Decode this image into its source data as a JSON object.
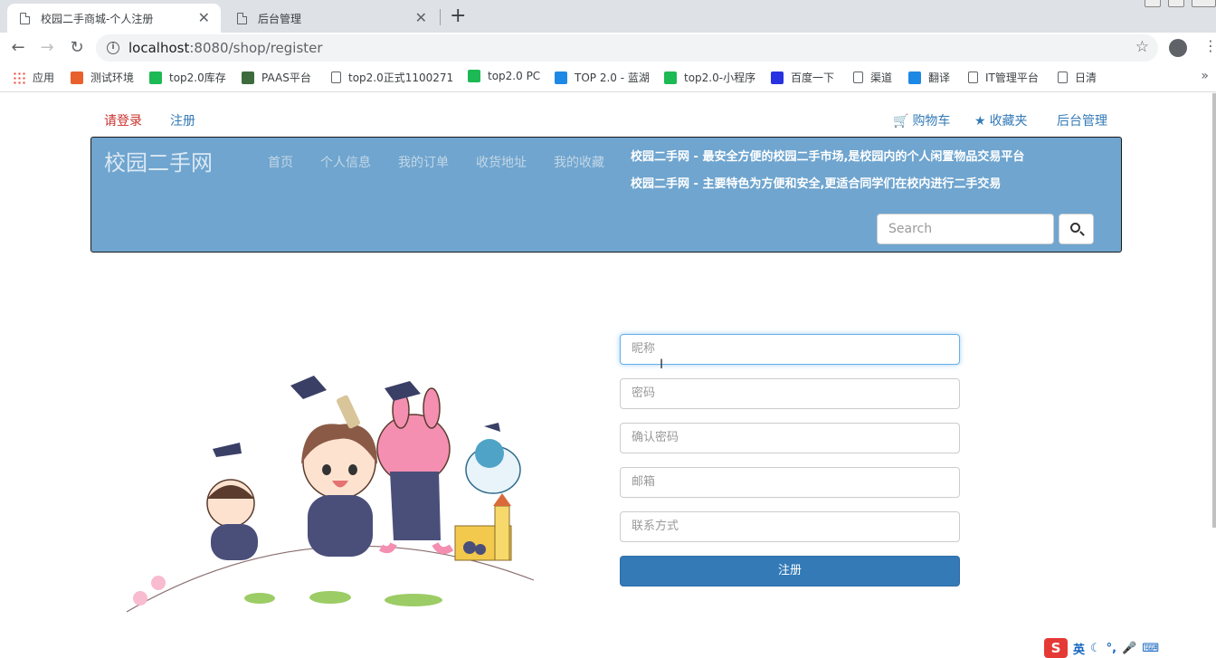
{
  "browser": {
    "tabs": [
      {
        "title": "校园二手商城-个人注册",
        "active": true
      },
      {
        "title": "后台管理",
        "active": false
      }
    ],
    "new_tab": "+",
    "url_host": "localhost",
    "url_rest": ":8080/shop/register",
    "bookmarks": [
      {
        "label": "应用",
        "icon": "apps-icon"
      },
      {
        "label": "测试环境",
        "icon": "u-icon",
        "color": "#e8602c"
      },
      {
        "label": "top2.0库存",
        "icon": "play-icon",
        "color": "#1db954"
      },
      {
        "label": "PAAS平台",
        "icon": "globe-icon",
        "color": "#3d6b3d"
      },
      {
        "label": "top2.0正式1100271",
        "icon": "doc-icon"
      },
      {
        "label": "top2.0 PC",
        "icon": "play-icon",
        "color": "#1db954"
      },
      {
        "label": "TOP 2.0 - 蓝湖",
        "icon": "lanhu-icon",
        "color": "#1e88e5"
      },
      {
        "label": "top2.0-小程序",
        "icon": "play-icon",
        "color": "#1db954"
      },
      {
        "label": "百度一下",
        "icon": "baidu-icon",
        "color": "#2932e1"
      },
      {
        "label": "渠道",
        "icon": "doc-icon"
      },
      {
        "label": "翻译",
        "icon": "translate-icon",
        "color": "#1e88e5"
      },
      {
        "label": "IT管理平台",
        "icon": "doc-icon"
      },
      {
        "label": "日清",
        "icon": "doc-icon"
      }
    ],
    "more_bookmarks": "»"
  },
  "top_links": {
    "login": "请登录",
    "register": "注册",
    "cart": "购物车",
    "favorites": "收藏夹",
    "admin": "后台管理"
  },
  "header": {
    "brand": "校园二手网",
    "nav": [
      "首页",
      "个人信息",
      "我的订单",
      "收货地址",
      "我的收藏"
    ],
    "slogan1": "校园二手网 - 最安全方便的校园二手市场,是校园内的个人闲置物品交易平台",
    "slogan2": "校园二手网 - 主要特色为方便和安全,更适合同学们在校内进行二手交易",
    "search_placeholder": "Search",
    "bg_color": "#6fa5cf"
  },
  "form": {
    "nickname_placeholder": "昵称",
    "password_placeholder": "密码",
    "confirm_placeholder": "确认密码",
    "email_placeholder": "邮箱",
    "contact_placeholder": "联系方式",
    "submit_label": "注册",
    "accent_color": "#337ab7"
  },
  "ime": {
    "logo": "S",
    "lang": "英"
  }
}
